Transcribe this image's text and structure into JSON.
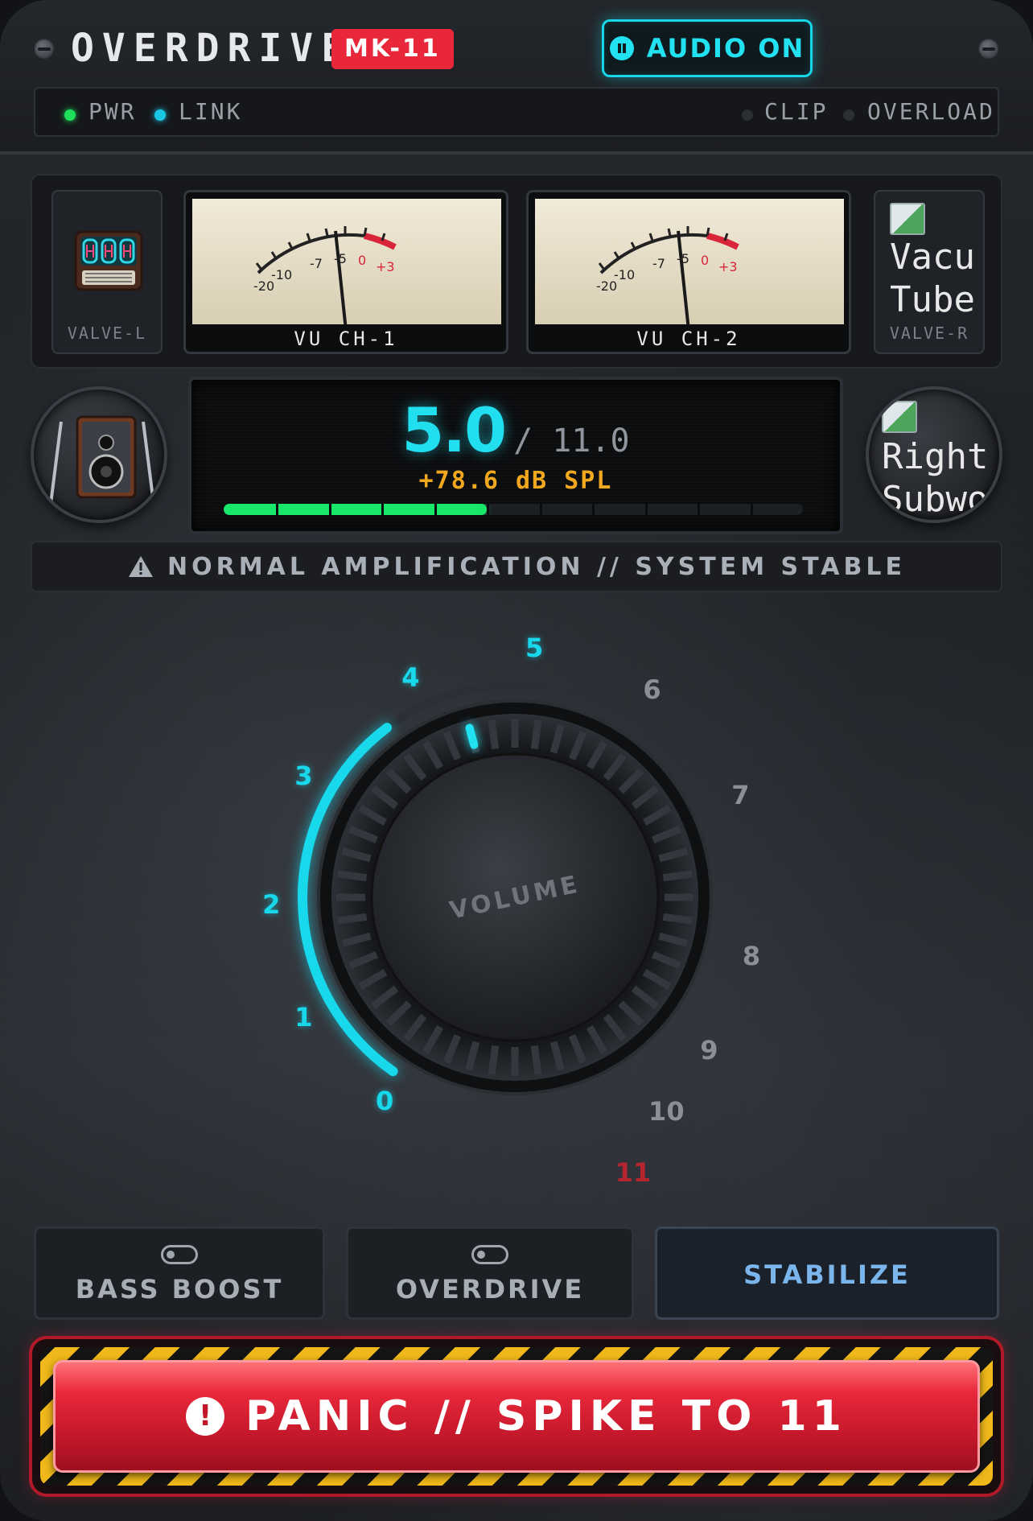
{
  "header": {
    "brand": "OVERDRIVE",
    "model": "MK-11",
    "audio_button": "AUDIO ON"
  },
  "indicators": {
    "pwr": "PWR",
    "link": "LINK",
    "clip": "CLIP",
    "overload": "OVERLOAD"
  },
  "meters": {
    "valve_left_caption": "VALVE-L",
    "valve_right_caption": "VALVE-R",
    "valve_right_alt_line1": "Vacu",
    "valve_right_alt_line2": "Tube",
    "vu1_caption": "VU CH-1",
    "vu2_caption": "VU CH-2",
    "vu_scale": [
      "-20",
      "-10",
      "-7",
      "-5",
      "0",
      "+3"
    ]
  },
  "readout": {
    "value": "5.0",
    "max": "/ 11.0",
    "spl": "+78.6 dB SPL",
    "level_fraction": 0.4545,
    "segments": 11
  },
  "right_sub": {
    "alt_line1": "Right",
    "alt_line2": "Subwo"
  },
  "status": {
    "message": "NORMAL AMPLIFICATION // SYSTEM STABLE"
  },
  "dial": {
    "label": "VOLUME",
    "scale": [
      "0",
      "1",
      "2",
      "3",
      "4",
      "5",
      "6",
      "7",
      "8",
      "9",
      "10",
      "11"
    ],
    "value": 5,
    "max": 11
  },
  "toggles": {
    "bass_boost": "BASS BOOST",
    "overdrive": "OVERDRIVE",
    "stabilize": "STABILIZE"
  },
  "panic": {
    "label": "PANIC // SPIKE TO 11"
  },
  "colors": {
    "accent_cyan": "#22e2f2",
    "brand_red": "#e8283a",
    "level_green": "#17e86a",
    "spl_amber": "#f1a81e",
    "hazard_yellow": "#f0b81a"
  },
  "icons": {
    "audio_button": "pause-icon",
    "status": "warning-triangle-icon",
    "panic": "exclamation-icon",
    "valve_left": "vacuum-tube-icon",
    "left_speaker": "speaker-icon"
  }
}
